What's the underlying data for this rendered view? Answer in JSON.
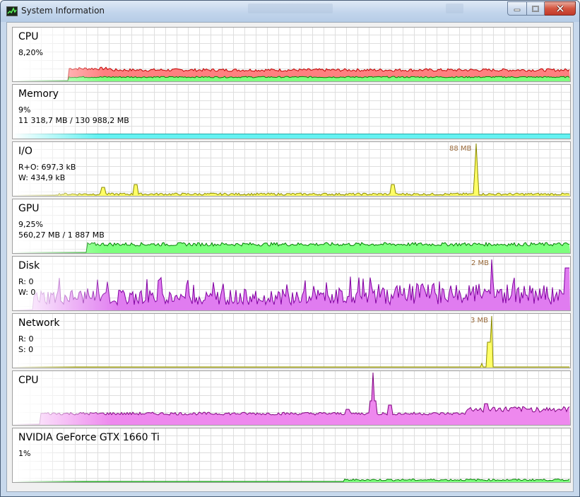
{
  "window": {
    "title": "System Information",
    "icon": "graph-icon",
    "controls": [
      "minimize-icon",
      "maximize-icon",
      "close-icon"
    ]
  },
  "panels": [
    {
      "id": "cpu",
      "title": "CPU",
      "line1": "8,20%",
      "line2": "",
      "fill_colors": [
        "#ff8080",
        "#80ff80"
      ],
      "line_colors": [
        "#c00000",
        "#008000"
      ]
    },
    {
      "id": "memory",
      "title": "Memory",
      "line1": "9%",
      "line2": "11 318,7 MB / 130 988,2 MB",
      "usage_fraction": 0.09,
      "fill_color": "#66f2f2"
    },
    {
      "id": "io",
      "title": "I/O",
      "line1": "R+O: 697,3 kB",
      "line2": "W: 434,9 kB",
      "peak_label": "88 MB",
      "fill_color": "#ffff66",
      "line_color": "#8a8a00"
    },
    {
      "id": "gpu",
      "title": "GPU",
      "line1": "9,25%",
      "line2": "560,27 MB / 1 887 MB",
      "fill_color": "#7dff7d",
      "line_color": "#008000"
    },
    {
      "id": "disk",
      "title": "Disk",
      "line1": "R: 0",
      "line2": "W: 0",
      "peak_label": "2 MB",
      "fill_color": "#e07cf0",
      "line_color": "#8000a0"
    },
    {
      "id": "network",
      "title": "Network",
      "line1": "R: 0",
      "line2": "S: 0",
      "peak_label": "3 MB",
      "fill_color": "#ffff66",
      "line_color": "#8a8a00"
    },
    {
      "id": "cpu2",
      "title": "CPU",
      "line1": "",
      "line2": "",
      "fill_color": "#ee88ee",
      "line_color": "#800080"
    },
    {
      "id": "gpu2",
      "title": "NVIDIA GeForce GTX 1660 Ti",
      "line1": "1%",
      "line2": "",
      "fill_color": "#7dff7d",
      "line_color": "#008000"
    }
  ]
}
